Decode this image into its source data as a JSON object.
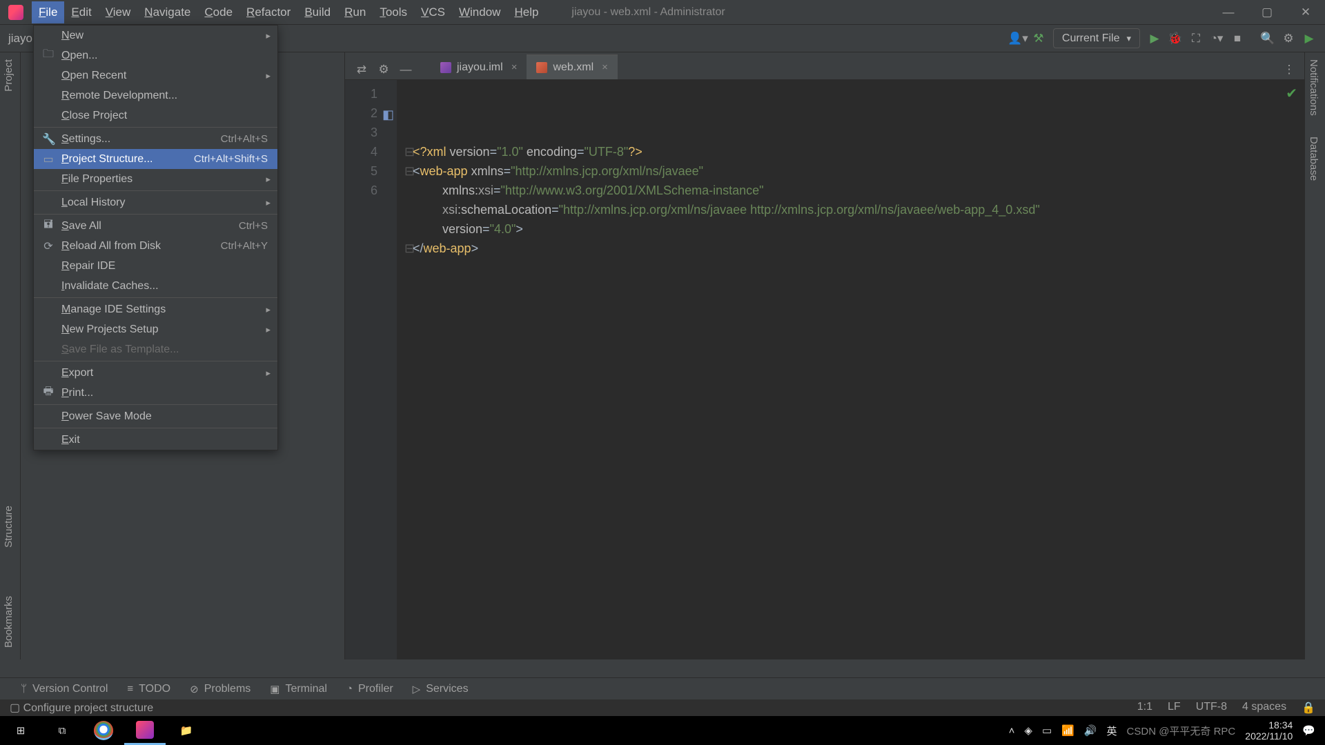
{
  "window": {
    "title": "jiayou - web.xml - Administrator"
  },
  "menubar": [
    "File",
    "Edit",
    "View",
    "Navigate",
    "Code",
    "Refactor",
    "Build",
    "Run",
    "Tools",
    "VCS",
    "Window",
    "Help"
  ],
  "menubar_mnemonics": [
    "F",
    "E",
    "V",
    "N",
    "C",
    "R",
    "B",
    "R",
    "T",
    "V",
    "W",
    "H"
  ],
  "breadcrumb": "jiayo",
  "run_config": "Current File",
  "file_menu": [
    {
      "label": "New",
      "submenu": true
    },
    {
      "label": "Open...",
      "icon": "folder"
    },
    {
      "label": "Open Recent",
      "submenu": true
    },
    {
      "label": "Remote Development..."
    },
    {
      "label": "Close Project"
    },
    {
      "sep": true
    },
    {
      "label": "Settings...",
      "shortcut": "Ctrl+Alt+S",
      "icon": "wrench"
    },
    {
      "label": "Project Structure...",
      "shortcut": "Ctrl+Alt+Shift+S",
      "icon": "struct",
      "selected": true
    },
    {
      "label": "File Properties",
      "submenu": true
    },
    {
      "sep": true
    },
    {
      "label": "Local History",
      "submenu": true
    },
    {
      "sep": true
    },
    {
      "label": "Save All",
      "shortcut": "Ctrl+S",
      "icon": "save"
    },
    {
      "label": "Reload All from Disk",
      "shortcut": "Ctrl+Alt+Y",
      "icon": "reload"
    },
    {
      "label": "Repair IDE"
    },
    {
      "label": "Invalidate Caches..."
    },
    {
      "sep": true
    },
    {
      "label": "Manage IDE Settings",
      "submenu": true
    },
    {
      "label": "New Projects Setup",
      "submenu": true
    },
    {
      "label": "Save File as Template...",
      "disabled": true
    },
    {
      "sep": true
    },
    {
      "label": "Export",
      "submenu": true
    },
    {
      "label": "Print...",
      "icon": "print"
    },
    {
      "sep": true
    },
    {
      "label": "Power Save Mode"
    },
    {
      "sep": true
    },
    {
      "label": "Exit"
    }
  ],
  "tabs": [
    {
      "name": "jiayou.iml",
      "type": "iml",
      "active": false
    },
    {
      "name": "web.xml",
      "type": "xml",
      "active": true
    }
  ],
  "editor": {
    "lines": [
      1,
      2,
      3,
      4,
      5,
      6
    ],
    "code_plain": "<?xml version=\"1.0\" encoding=\"UTF-8\"?>\n<web-app xmlns=\"http://xmlns.jcp.org/xml/ns/javaee\"\n         xmlns:xsi=\"http://www.w3.org/2001/XMLSchema-instance\"\n         xsi:schemaLocation=\"http://xmlns.jcp.org/xml/ns/javaee http://xmlns.jcp.org/xml/ns/javaee/web-app_4_0.xsd\"\n         version=\"4.0\">\n</web-app>"
  },
  "left_tools": [
    "Project",
    "Structure",
    "Bookmarks"
  ],
  "right_tools": [
    "Notifications",
    "Database"
  ],
  "bottom_tools": [
    {
      "label": "Version Control",
      "icon": "branch"
    },
    {
      "label": "TODO",
      "icon": "list"
    },
    {
      "label": "Problems",
      "icon": "warn"
    },
    {
      "label": "Terminal",
      "icon": "term"
    },
    {
      "label": "Profiler",
      "icon": "gauge"
    },
    {
      "label": "Services",
      "icon": "play"
    }
  ],
  "status": {
    "left": "Configure project structure",
    "pos": "1:1",
    "eol": "LF",
    "enc": "UTF-8",
    "indent": "4 spaces"
  },
  "taskbar": {
    "time": "18:34",
    "date": "2022/11/10",
    "watermark": "CSDN @平平无奇 RPC"
  }
}
